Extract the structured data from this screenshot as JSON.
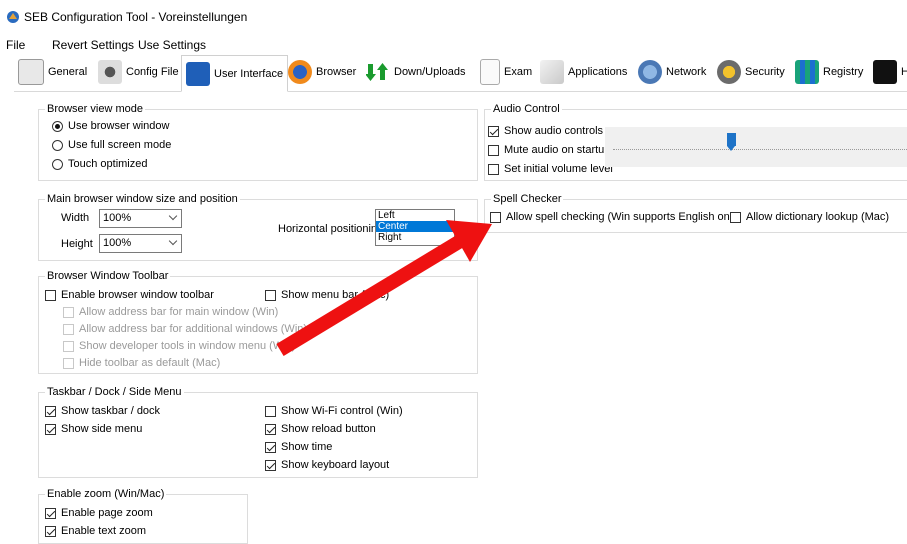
{
  "window": {
    "title": "SEB Configuration Tool - Voreinstellungen"
  },
  "menu": [
    "File",
    "Revert Settings",
    "Use Settings"
  ],
  "tabs": [
    {
      "label": "General",
      "icon": "general-icon"
    },
    {
      "label": "Config File",
      "icon": "gears-icon"
    },
    {
      "label": "User Interface",
      "icon": "user-interface-icon",
      "active": true
    },
    {
      "label": "Browser",
      "icon": "browser-icon"
    },
    {
      "label": "Down/Uploads",
      "icon": "down-uploads-icon"
    },
    {
      "label": "Exam",
      "icon": "exam-icon"
    },
    {
      "label": "Applications",
      "icon": "applications-icon"
    },
    {
      "label": "Network",
      "icon": "network-icon"
    },
    {
      "label": "Security",
      "icon": "security-icon"
    },
    {
      "label": "Registry",
      "icon": "registry-icon"
    },
    {
      "label": "H",
      "icon": "hook-icon"
    }
  ],
  "browser_view_mode": {
    "legend": "Browser view mode",
    "options": [
      {
        "label": "Use browser window",
        "checked": true
      },
      {
        "label": "Use full screen mode",
        "checked": false
      },
      {
        "label": "Touch optimized",
        "checked": false
      }
    ]
  },
  "main_window": {
    "legend": "Main browser window size and position",
    "width_label": "Width",
    "width_value": "100%",
    "height_label": "Height",
    "height_value": "100%",
    "hpos_label": "Horizontal positioning",
    "hpos_options": [
      "Left",
      "Center",
      "Right"
    ],
    "hpos_selected": "Center"
  },
  "toolbar": {
    "legend": "Browser Window Toolbar",
    "enable": {
      "label": "Enable browser window toolbar",
      "checked": false
    },
    "show_menu_bar": {
      "label": "Show menu bar (Mac)",
      "checked": false
    },
    "sub": [
      "Allow address bar for main window (Win)",
      "Allow address bar for additional windows (Win)",
      "Show developer tools in window menu (Win)",
      "Hide toolbar as default (Mac)"
    ]
  },
  "taskbar": {
    "legend": "Taskbar / Dock / Side Menu",
    "show_taskbar": {
      "label": "Show taskbar / dock",
      "checked": true
    },
    "show_side_menu": {
      "label": "Show side menu",
      "checked": true
    },
    "show_wifi": {
      "label": "Show Wi-Fi control (Win)",
      "checked": false
    },
    "show_reload": {
      "label": "Show reload button",
      "checked": true
    },
    "show_time": {
      "label": "Show time",
      "checked": true
    },
    "show_keyboard": {
      "label": "Show keyboard layout",
      "checked": true
    }
  },
  "zoom": {
    "legend": "Enable zoom (Win/Mac)",
    "page_zoom": {
      "label": "Enable page zoom",
      "checked": true
    },
    "text_zoom": {
      "label": "Enable text zoom",
      "checked": true
    }
  },
  "audio": {
    "legend": "Audio Control",
    "show_controls": {
      "label": "Show audio controls",
      "checked": true
    },
    "mute": {
      "label": "Mute audio on startup",
      "checked": false
    },
    "initial_volume": {
      "label": "Set initial volume level",
      "checked": false
    },
    "volume_fraction": 0.4
  },
  "spell": {
    "legend": "Spell Checker",
    "allow_spell": {
      "label": "Allow spell checking (Win supports English only)",
      "checked": false
    },
    "allow_dict": {
      "label": "Allow dictionary lookup (Mac)",
      "checked": false
    }
  },
  "colors": {
    "accent": "#0078d7",
    "annotation_arrow": "#ee1111"
  }
}
